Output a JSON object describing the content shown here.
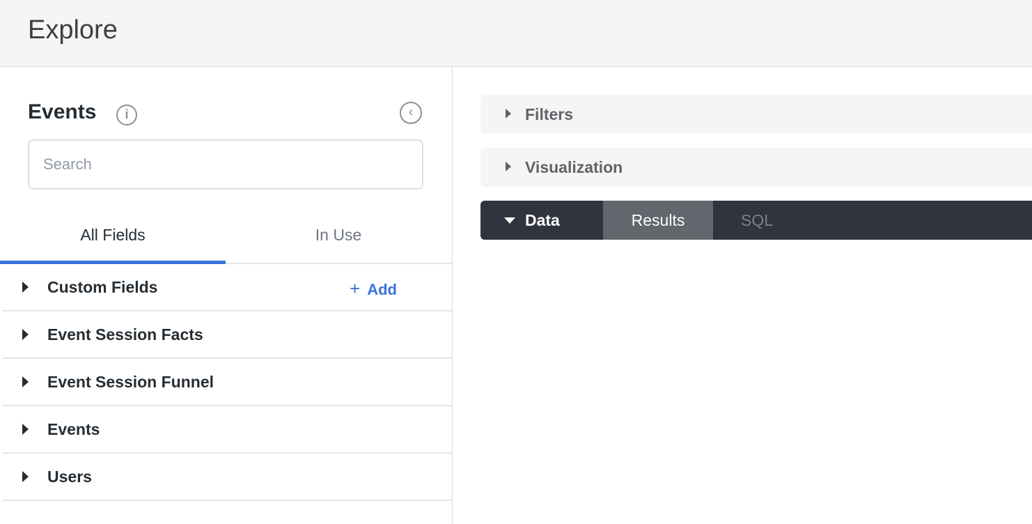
{
  "header": {
    "title": "Explore"
  },
  "sidebar": {
    "title": "Events",
    "search_placeholder": "Search",
    "search_value": "",
    "tabs": [
      {
        "label": "All Fields",
        "active": true
      },
      {
        "label": "In Use",
        "active": false
      }
    ],
    "groups": [
      {
        "label": "Custom Fields"
      },
      {
        "label": "Event Session Facts"
      },
      {
        "label": "Event Session Funnel"
      },
      {
        "label": "Events"
      },
      {
        "label": "Users"
      }
    ],
    "add_label": "Add",
    "add_icon": "+"
  },
  "main": {
    "filters_label": "Filters",
    "visualization_label": "Visualization",
    "data_label": "Data",
    "data_tabs": [
      {
        "label": "Results",
        "active": true
      },
      {
        "label": "SQL",
        "active": false
      }
    ]
  },
  "colors": {
    "accent": "#3a73d9",
    "data_bar": "#31343f",
    "results_tab": "#63666d",
    "panel_bg": "#f5f5f5"
  }
}
